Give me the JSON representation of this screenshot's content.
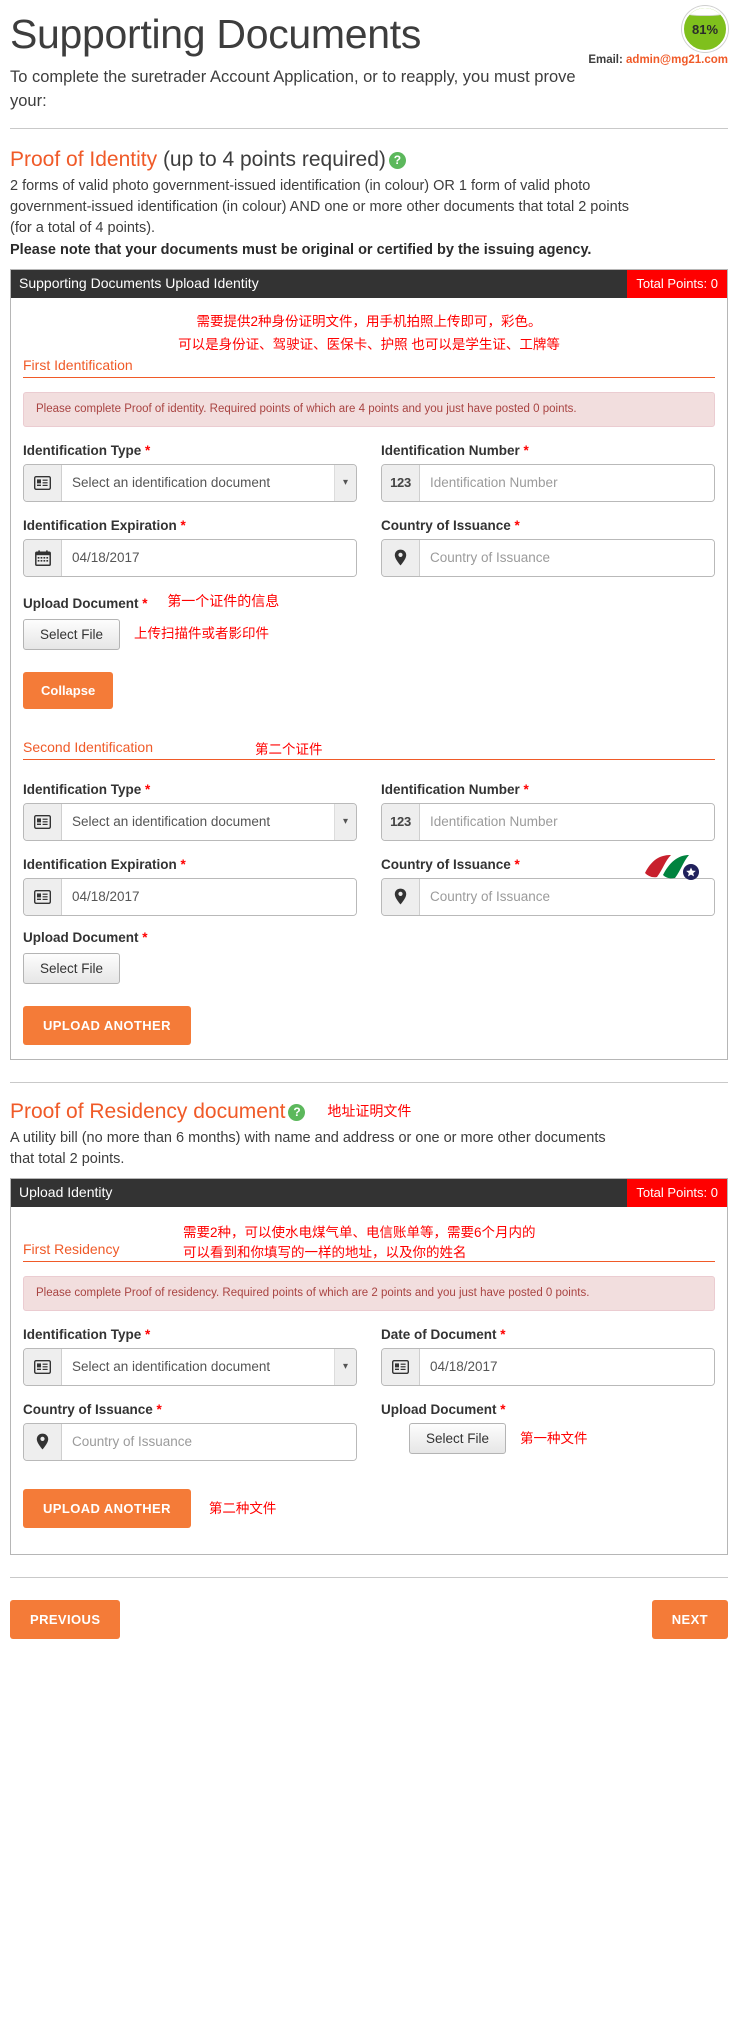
{
  "header": {
    "title": "Supporting Documents",
    "progress": "81%",
    "email_label": "Email:",
    "email_address": "admin@mg21.com",
    "intro": "To complete the suretrader Account Application, or to reapply, you must prove your:"
  },
  "identity_section": {
    "heading_accent": "Proof of Identity",
    "heading_rest": "(up to 4 points required)",
    "help_icon": "question-mark-icon",
    "description": "2 forms of valid photo government-issued identification (in colour) OR 1 form of valid photo government-issued identification (in colour) AND one or more other documents that total 2 points (for a total of 4 points).",
    "note": "Please note that your documents must be original or certified by the issuing agency.",
    "panel_title": "Supporting Documents Upload Identity",
    "total_points": "Total Points: 0",
    "annotation_line1": "需要提供2种身份证明文件，用手机拍照上传即可，彩色。",
    "annotation_line2": "可以是身份证、驾驶证、医保卡、护照  也可以是学生证、工牌等",
    "first": {
      "sub_heading": "First Identification",
      "alert": "Please complete Proof of identity. Required points of which are 4 points and you just have posted 0 points.",
      "id_type_label": "Identification Type",
      "id_type_value": "Select an identification document",
      "id_number_label": "Identification Number",
      "id_number_placeholder": "Identification Number",
      "id_number_addon": "123",
      "expiration_label": "Identification Expiration",
      "expiration_value": "04/18/2017",
      "country_label": "Country of Issuance",
      "country_placeholder": "Country of Issuance",
      "upload_label": "Upload Document",
      "select_file": "Select File",
      "collapse": "Collapse",
      "annotation_upload_title": "第一个证件的信息",
      "annotation_select_file": "上传扫描件或者影印件"
    },
    "second": {
      "sub_heading": "Second Identification",
      "annotation": "第二个证件",
      "id_type_label": "Identification Type",
      "id_type_value": "Select an identification document",
      "id_number_label": "Identification Number",
      "id_number_placeholder": "Identification Number",
      "id_number_addon": "123",
      "expiration_label": "Identification Expiration",
      "expiration_value": "04/18/2017",
      "country_label": "Country of Issuance",
      "country_placeholder": "Country of Issuance",
      "upload_label": "Upload Document",
      "select_file": "Select File",
      "upload_another": "UPLOAD ANOTHER"
    }
  },
  "residency_section": {
    "heading_accent": "Proof of Residency document",
    "help_icon": "question-mark-icon",
    "annotation_heading": "地址证明文件",
    "description": "A utility bill (no more than 6 months) with name and address or one or more other documents that total 2 points.",
    "panel_title": "Upload Identity",
    "total_points": "Total Points: 0",
    "first": {
      "sub_heading": "First Residency",
      "annotation_line1": "需要2种，可以使水电煤气单、电信账单等，需要6个月内的",
      "annotation_line2": "可以看到和你填写的一样的地址，以及你的姓名",
      "alert": "Please complete Proof of residency. Required points of which are 2 points and you just have posted 0 points.",
      "id_type_label": "Identification Type",
      "id_type_value": "Select an identification document",
      "date_label": "Date of Document",
      "date_value": "04/18/2017",
      "country_label": "Country of Issuance",
      "country_placeholder": "Country of Issuance",
      "upload_label": "Upload Document",
      "select_file": "Select File",
      "annotation_select_file": "第一种文件",
      "upload_another": "UPLOAD ANOTHER",
      "annotation_upload_another": "第二种文件"
    }
  },
  "footer": {
    "previous": "PREVIOUS",
    "next": "NEXT"
  },
  "colors": {
    "accent_orange": "#f05a28",
    "button_orange": "#f47b38",
    "panel_dark": "#333333",
    "points_red": "#ff0000",
    "progress_green": "#7fc01c",
    "annotation_red": "#ff0000"
  }
}
